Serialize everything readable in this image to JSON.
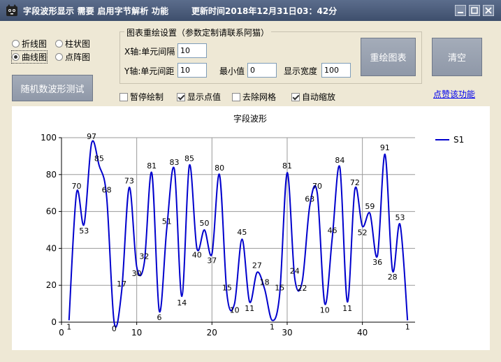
{
  "window": {
    "title": "字段波形显示 需要 启用字节解析 功能",
    "time_text": "更新时间2018年12月31日03：42分"
  },
  "chart_type_options": [
    {
      "label": "折线图",
      "selected": false
    },
    {
      "label": "柱状图",
      "selected": false
    },
    {
      "label": "曲线图",
      "selected": true
    },
    {
      "label": "点阵图",
      "selected": false
    }
  ],
  "buttons": {
    "random_test": "随机数波形测试",
    "redraw": "重绘图表",
    "clear": "清空"
  },
  "settings": {
    "title": "图表重绘设置（参数定制请联系阿猫）",
    "x_interval_label": "X轴:单元间隔",
    "x_interval_value": "10",
    "y_interval_label": "Y轴:单元间距",
    "y_interval_value": "10",
    "min_label": "最小值",
    "min_value": "0",
    "width_label": "显示宽度",
    "width_value": "100"
  },
  "checkboxes": [
    {
      "label": "暂停绘制",
      "checked": false
    },
    {
      "label": "显示点值",
      "checked": true
    },
    {
      "label": "去除网格",
      "checked": false
    },
    {
      "label": "自动缩放",
      "checked": true
    }
  ],
  "like_link": "点赞该功能",
  "colors": {
    "series": "#0000cd",
    "accent": "#3e4f6c"
  },
  "chart_data": {
    "type": "line",
    "title": "字段波形",
    "series": [
      {
        "name": "S1",
        "values": [
          1,
          70,
          53,
          97,
          85,
          68,
          0,
          17,
          73,
          30,
          32,
          81,
          6,
          51,
          83,
          14,
          85,
          40,
          50,
          37,
          80,
          15,
          10,
          45,
          11,
          27,
          18,
          1,
          15,
          81,
          24,
          22,
          63,
          70,
          10,
          46,
          84,
          11,
          72,
          52,
          59,
          36,
          91,
          28,
          53,
          1
        ]
      }
    ],
    "x": [
      1,
      2,
      3,
      4,
      5,
      6,
      7,
      8,
      9,
      10,
      11,
      12,
      13,
      14,
      15,
      16,
      17,
      18,
      19,
      20,
      21,
      22,
      23,
      24,
      25,
      26,
      27,
      28,
      29,
      30,
      31,
      32,
      33,
      34,
      35,
      36,
      37,
      38,
      39,
      40,
      41,
      42,
      43,
      44,
      45,
      46
    ],
    "xlim": [
      0,
      47
    ],
    "ylim": [
      0,
      100
    ],
    "xticks": [
      0,
      10,
      20,
      30,
      40
    ],
    "yticks": [
      0,
      20,
      40,
      60,
      80,
      100
    ],
    "grid": true,
    "smooth": true,
    "show_point_labels": true,
    "legend": "top-right"
  }
}
